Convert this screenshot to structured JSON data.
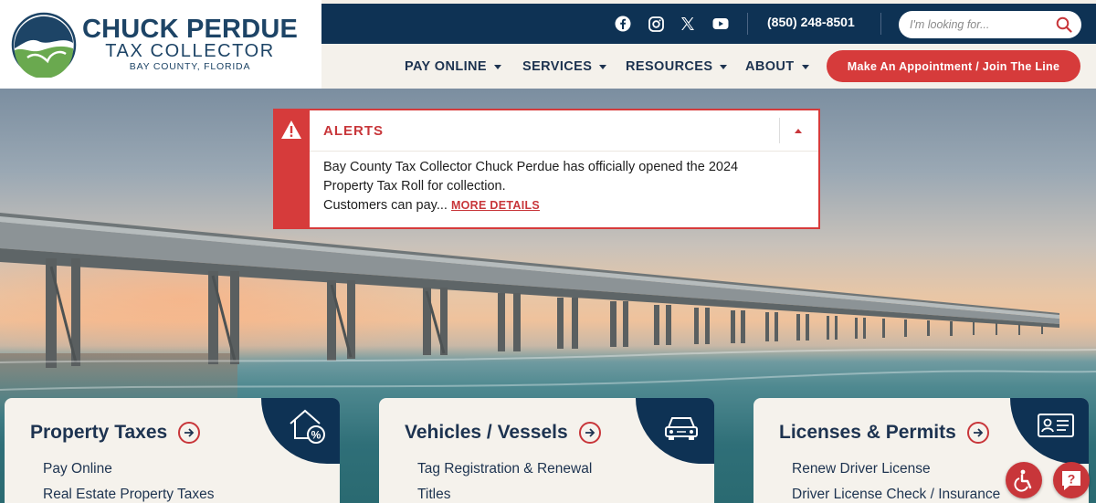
{
  "brand": {
    "title": "CHUCK PERDUE",
    "subtitle": "TAX COLLECTOR",
    "county": "BAY COUNTY, FLORIDA",
    "navy": "#0e3254",
    "red": "#d63b3b"
  },
  "topbar": {
    "social_icons": [
      "facebook-icon",
      "instagram-icon",
      "x-icon",
      "youtube-icon"
    ],
    "phone": "(850) 248-8501",
    "search_placeholder": "I'm looking for..."
  },
  "nav": {
    "items": [
      {
        "label": "PAY ONLINE"
      },
      {
        "label": "SERVICES"
      },
      {
        "label": "RESOURCES"
      },
      {
        "label": "ABOUT"
      }
    ],
    "cta": "Make An Appointment /  Join The Line"
  },
  "alert": {
    "title": "ALERTS",
    "line1": "Bay County Tax Collector Chuck Perdue has officially opened the 2024",
    "line2": "Property Tax Roll for collection.",
    "line3": "Customers can pay...",
    "link": "MORE DETAILS"
  },
  "cards": [
    {
      "title": "Property Taxes",
      "icon": "house-percent-icon",
      "links": [
        "Pay Online",
        "Real Estate Property Taxes"
      ]
    },
    {
      "title": "Vehicles / Vessels",
      "icon": "car-icon",
      "links": [
        "Tag Registration & Renewal",
        "Titles"
      ]
    },
    {
      "title": "Licenses & Permits",
      "icon": "id-card-icon",
      "links": [
        "Renew Driver License",
        "Driver License Check / Insurance"
      ]
    }
  ],
  "floating": [
    "accessibility-icon",
    "help-icon"
  ]
}
